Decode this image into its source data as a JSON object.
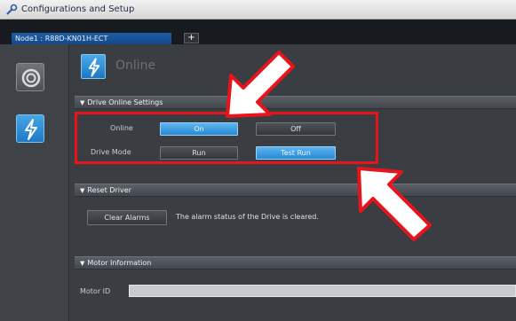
{
  "window": {
    "title": "Configurations and Setup"
  },
  "tabs": [
    {
      "label": "Node1 : R88D-KN01H-ECT"
    }
  ],
  "tab_add_label": "+",
  "page": {
    "title": "Online"
  },
  "drive_online_settings": {
    "header": "Drive Online Settings",
    "online_label": "Online",
    "online_on": "On",
    "online_off": "Off",
    "drive_mode_label": "Drive Mode",
    "mode_run": "Run",
    "mode_test_run": "Test Run"
  },
  "reset_driver": {
    "header": "Reset Driver",
    "clear_alarms": "Clear Alarms",
    "status": "The alarm status of the Drive is cleared."
  },
  "motor_information": {
    "header": "Motor Information",
    "motor_id_label": "Motor ID",
    "motor_id_value": ""
  },
  "colors": {
    "accent": "#2888d4",
    "highlight": "#e8141b",
    "background": "#3a3d42"
  },
  "icons": {
    "app": "wrench-icon",
    "rail_top": "drive-info-icon",
    "rail_selected": "lightning-icon",
    "header": "lightning-icon"
  }
}
